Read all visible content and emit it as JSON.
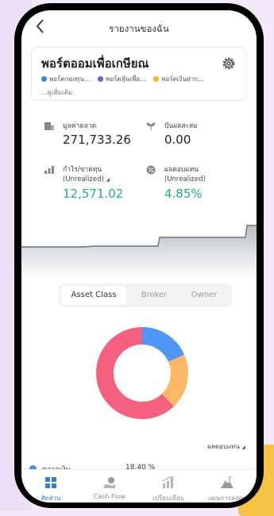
{
  "header": {
    "title": "รายงานของฉัน"
  },
  "portfolio": {
    "name": "พอร์ตออมเพื่อเกษียณ",
    "tags": [
      {
        "label": "พอร์ตกองทุน...",
        "color": "#2a8ee8"
      },
      {
        "label": "พอร์ตหุ้นเพื่อ...",
        "color": "#7b57d6"
      },
      {
        "label": "พอร์ตเงินฝาก...",
        "color": "#f2b91f"
      }
    ],
    "more": "...ดูเพิ่มเติม"
  },
  "metrics": {
    "market_value": {
      "label": "มูลค่าตลาด",
      "value": "271,733.26"
    },
    "cumulative_dividend": {
      "label": "ปันผลสะสม",
      "value": "0.00"
    },
    "profit_loss": {
      "label": "กำไร/ขาดทุน",
      "sublabel": "(Unrealized)",
      "value": "12,571.02"
    },
    "return": {
      "label": "ผลตอบแทน",
      "sublabel": "(Unrealized)",
      "value": "4.85%"
    }
  },
  "tabs": [
    {
      "label": "Asset Class",
      "active": true
    },
    {
      "label": "Broker",
      "active": false
    },
    {
      "label": "Owner",
      "active": false
    }
  ],
  "chart_data": {
    "type": "pie",
    "categories": [
      "",
      "",
      ""
    ],
    "values": [
      18.4,
      19.4,
      62.2
    ],
    "colors": [
      "#4f95f7",
      "#fcb867",
      "#f5607e"
    ]
  },
  "list": {
    "column_label": "ผลตอบแทน",
    "rows": [
      {
        "name": "ตลาดเงิน",
        "percent": "18.40 %",
        "color": "#3e8ef7"
      }
    ]
  },
  "bottom_nav": [
    {
      "label": "สัดส่วน",
      "icon": "grid-icon",
      "active": true
    },
    {
      "label": "Cash Flow",
      "icon": "cashflow-icon",
      "active": false
    },
    {
      "label": "เปรียบเทียบ",
      "icon": "compare-chart-icon",
      "active": false
    },
    {
      "label": "แผนการลงทุน",
      "icon": "mountain-icon",
      "active": false
    }
  ],
  "colors": {
    "accent": "#2f7de1",
    "positive": "#1fae85"
  }
}
